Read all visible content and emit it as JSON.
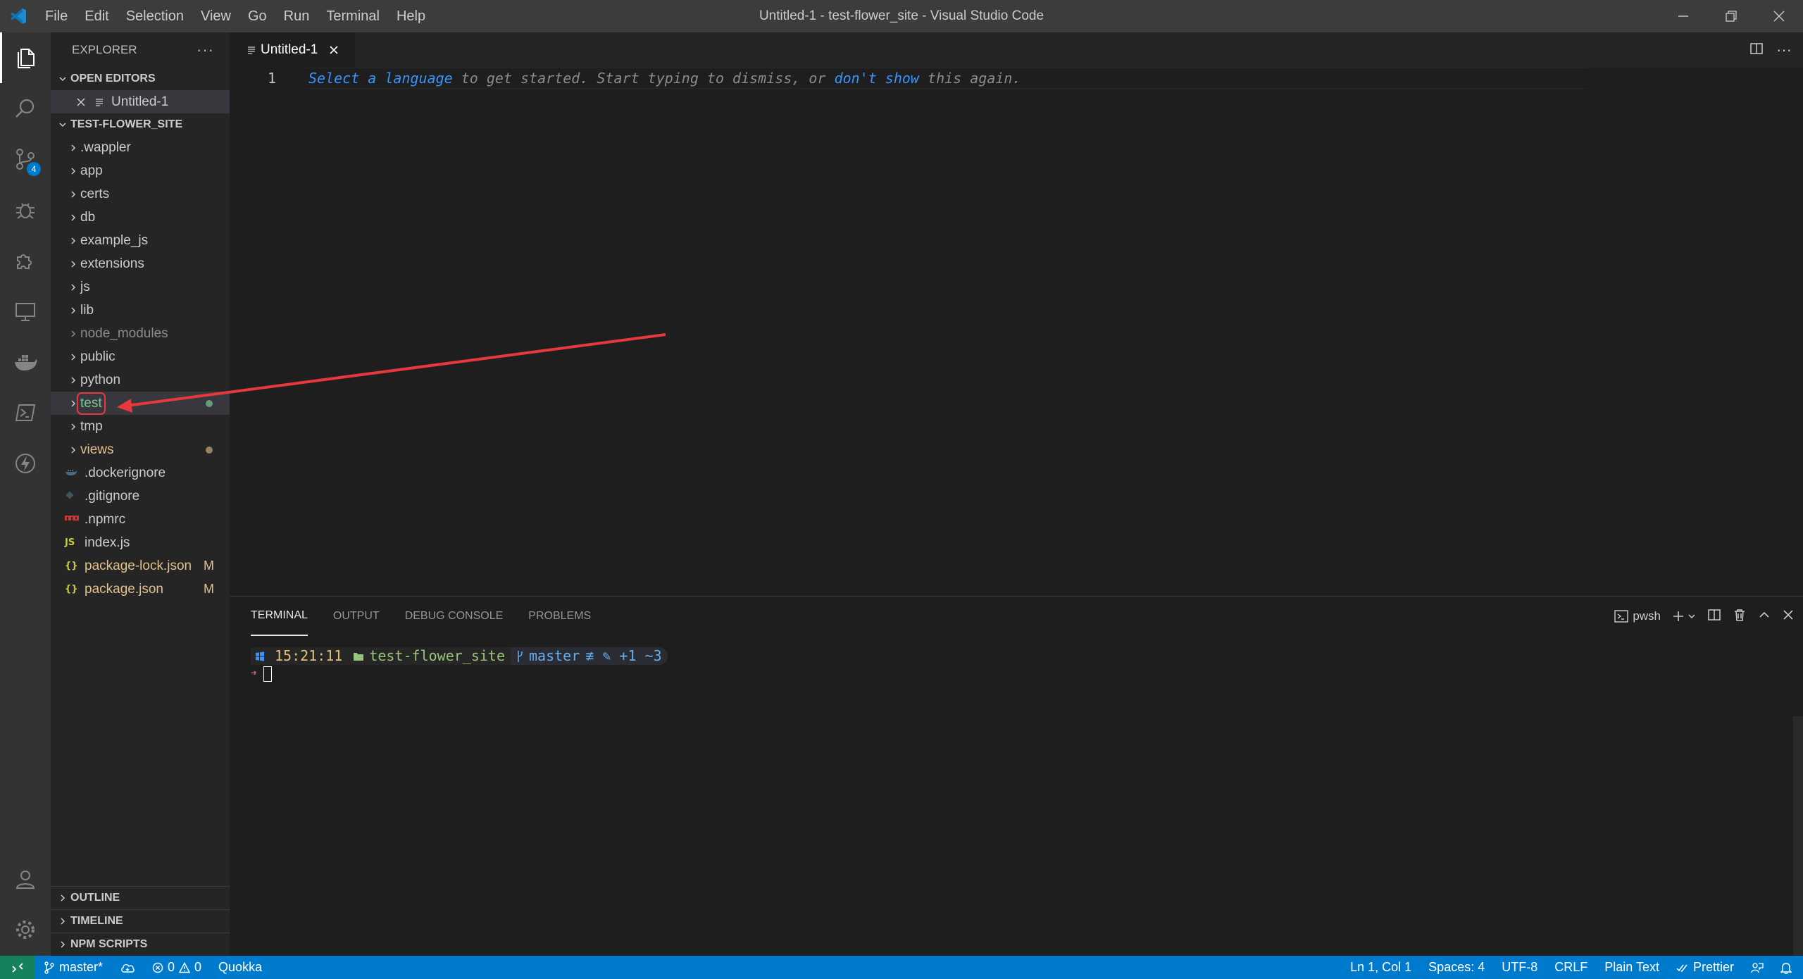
{
  "titlebar": {
    "menu": [
      "File",
      "Edit",
      "Selection",
      "View",
      "Go",
      "Run",
      "Terminal",
      "Help"
    ],
    "window_title": "Untitled-1 - test-flower_site - Visual Studio Code"
  },
  "activitybar": {
    "scm_badge": "4"
  },
  "sidebar": {
    "title": "EXPLORER",
    "open_editors_label": "OPEN EDITORS",
    "open_editor_file": "Untitled-1",
    "project_label": "TEST-FLOWER_SITE",
    "items": [
      {
        "label": ".wappler"
      },
      {
        "label": "app"
      },
      {
        "label": "certs"
      },
      {
        "label": "db"
      },
      {
        "label": "example_js"
      },
      {
        "label": "extensions"
      },
      {
        "label": "js"
      },
      {
        "label": "lib"
      },
      {
        "label": "node_modules"
      },
      {
        "label": "public"
      },
      {
        "label": "python"
      },
      {
        "label": "test"
      },
      {
        "label": "tmp"
      },
      {
        "label": "views"
      },
      {
        "label": ".dockerignore"
      },
      {
        "label": ".gitignore"
      },
      {
        "label": ".npmrc"
      },
      {
        "label": "index.js",
        "icon_text": "JS"
      },
      {
        "label": "package-lock.json",
        "icon_text": "{}",
        "status": "M"
      },
      {
        "label": "package.json",
        "icon_text": "{}",
        "status": "M"
      }
    ],
    "outline_label": "OUTLINE",
    "timeline_label": "TIMELINE",
    "npm_scripts_label": "NPM SCRIPTS"
  },
  "tabs": {
    "active_tab": "Untitled-1"
  },
  "editor": {
    "line_number": "1",
    "hint_part1": "Select a language",
    "hint_part2": " to get started. Start typing to dismiss, or ",
    "hint_part3": "don't show",
    "hint_part4": " this again."
  },
  "panel": {
    "tabs": [
      "TERMINAL",
      "OUTPUT",
      "DEBUG CONSOLE",
      "PROBLEMS"
    ],
    "shell_label": "pwsh",
    "prompt_time": "15:21:11",
    "prompt_dir": "test-flower_site",
    "prompt_branch": "master",
    "prompt_status": "≢ ✎ +1 ~3",
    "prompt_arrow": "➜"
  },
  "statusbar": {
    "branch": "master*",
    "errors": "0",
    "warnings": "0",
    "quokka": "Quokka",
    "position": "Ln 1, Col 1",
    "spaces": "Spaces: 4",
    "encoding": "UTF-8",
    "eol": "CRLF",
    "language": "Plain Text",
    "prettier": "Prettier"
  },
  "colors": {
    "accent": "#007acc",
    "annotation": "#e8383d",
    "modified": "#e2c08d",
    "untracked": "#73c991"
  }
}
